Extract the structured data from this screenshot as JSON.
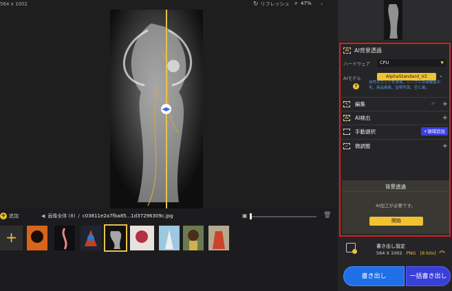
{
  "topbar": {
    "dimensions": "564 x 1002",
    "refresh_label": "リフレッシュ",
    "zoom": "47%"
  },
  "filmstrip": {
    "add_label": "追加",
    "folder_label": "画像全体 (8)",
    "separator": "/",
    "filename": "c03811e2a7fba85...1d37296309c.jpg"
  },
  "panel": {
    "ai_bg_title": "AI背景透過",
    "hardware_label": "ハードウェア",
    "hardware_value": "CPU",
    "ai_model_label": "AIモデル",
    "ai_model_value": "AlphaStandard_V2",
    "model_description": "自然なエッジを実現、シンプルな画像髪の毛、商品画像、証明写真、空と風。",
    "tools": {
      "edit": "編集",
      "ai_detect": "AI検出",
      "manual_select": "手動選択",
      "region_add": "+領域追加",
      "fine_adjust": "微調整"
    },
    "bg_card": {
      "title": "背景透過",
      "message": "AI加工が必要です。",
      "start": "開始"
    },
    "export": {
      "title": "書き出し設定",
      "dims": "564 X 1002",
      "format": "PNG",
      "bits": "[8 bits]"
    },
    "buttons": {
      "export": "書き出し",
      "batch_export": "一括書き出し"
    }
  },
  "colors": {
    "accent": "#f1c232",
    "highlight_border": "#e21c1c",
    "primary_button": "#1f6fe8",
    "secondary_button": "#3940d8"
  }
}
